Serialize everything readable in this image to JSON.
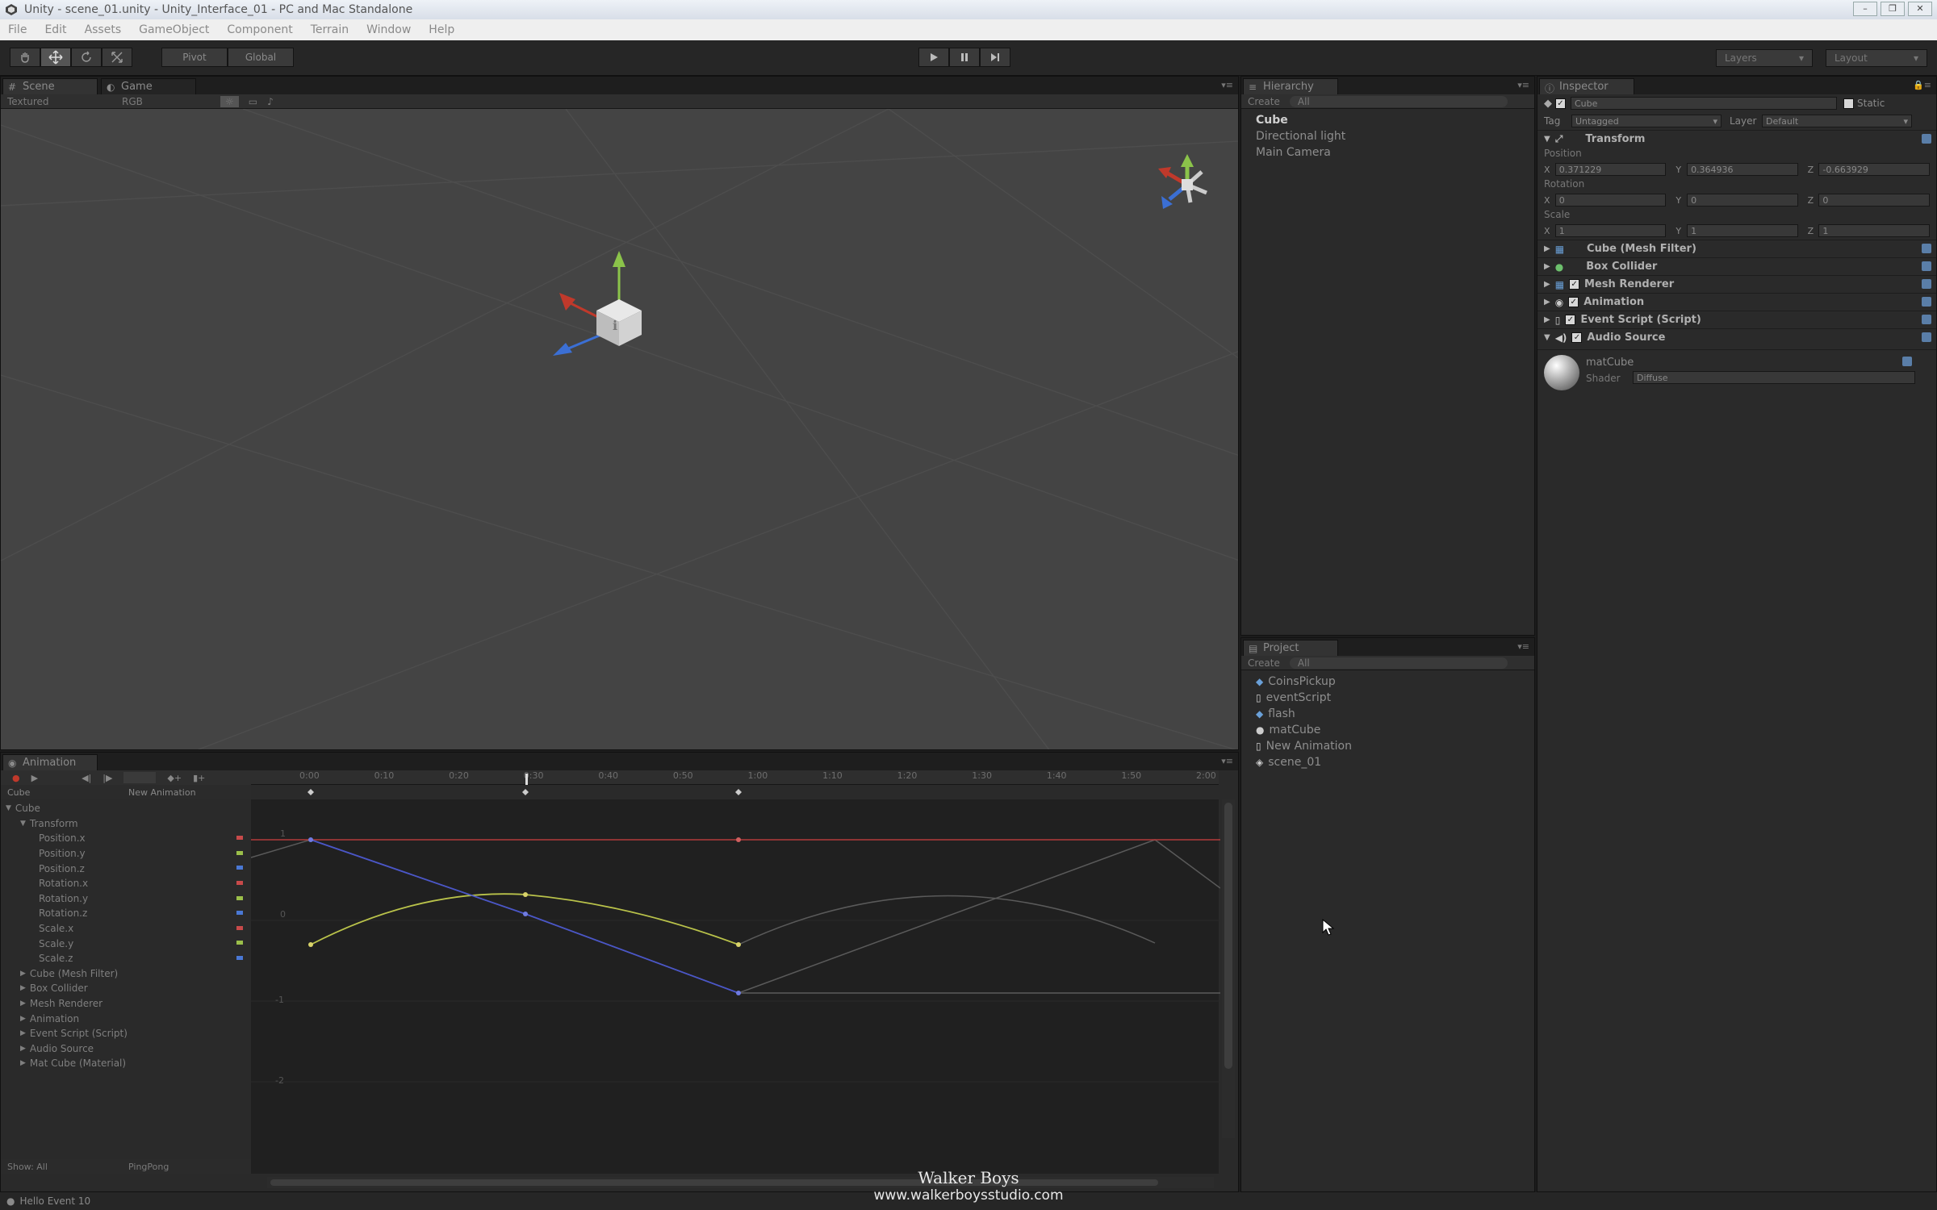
{
  "window": {
    "title": "Unity - scene_01.unity - Unity_Interface_01 - PC and Mac Standalone",
    "buttons": [
      "–",
      "❐",
      "✕"
    ]
  },
  "menu": [
    "File",
    "Edit",
    "Assets",
    "GameObject",
    "Component",
    "Terrain",
    "Window",
    "Help"
  ],
  "toolbar": {
    "tools": [
      "hand",
      "move",
      "rotate",
      "scale"
    ],
    "pivot_label": "Pivot",
    "global_label": "Global",
    "play_controls": [
      "play",
      "pause",
      "step"
    ],
    "layers_label": "Layers",
    "layout_label": "Layout"
  },
  "scene": {
    "tabs": [
      "Scene",
      "Game"
    ],
    "render_mode": "Textured",
    "color_mode": "RGB"
  },
  "hierarchy": {
    "tab": "Hierarchy",
    "create": "Create",
    "search": "All",
    "items": [
      "Cube",
      "Directional light",
      "Main Camera"
    ]
  },
  "project": {
    "tab": "Project",
    "create": "Create",
    "search": "All",
    "items": [
      {
        "label": "CoinsPickup",
        "icon": "prefab-icon"
      },
      {
        "label": "eventScript",
        "icon": "script-icon"
      },
      {
        "label": "flash",
        "icon": "prefab-icon"
      },
      {
        "label": "matCube",
        "icon": "material-icon"
      },
      {
        "label": "New Animation",
        "icon": "animation-icon"
      },
      {
        "label": "scene_01",
        "icon": "scene-icon"
      }
    ]
  },
  "inspector": {
    "tab": "Inspector",
    "object_name": "Cube",
    "static_label": "Static",
    "tag_label": "Tag",
    "tag_value": "Untagged",
    "layer_label": "Layer",
    "layer_value": "Default",
    "transform_label": "Transform",
    "position_label": "Position",
    "position": {
      "x": "0.371229",
      "y": "0.364936",
      "z": "-0.663929"
    },
    "rotation_label": "Rotation",
    "rotation": {
      "x": "0",
      "y": "0",
      "z": "0"
    },
    "scale_label": "Scale",
    "scale": {
      "x": "1",
      "y": "1",
      "z": "1"
    },
    "components": [
      "Cube (Mesh Filter)",
      "Box Collider",
      "Mesh Renderer",
      "Animation",
      "Event Script (Script)",
      "Audio Source"
    ],
    "material_name": "matCube",
    "shader_label": "Shader",
    "shader_value": "Diffuse"
  },
  "animation": {
    "tab": "Animation",
    "object": "Cube",
    "clip": "New Animation",
    "tree": [
      {
        "label": "Cube",
        "indent": 0
      },
      {
        "label": "Transform",
        "indent": 1
      },
      {
        "label": "Position.x",
        "indent": 2
      },
      {
        "label": "Position.y",
        "indent": 2
      },
      {
        "label": "Position.z",
        "indent": 2
      },
      {
        "label": "Rotation.x",
        "indent": 2
      },
      {
        "label": "Rotation.y",
        "indent": 2
      },
      {
        "label": "Rotation.z",
        "indent": 2
      },
      {
        "label": "Scale.x",
        "indent": 2
      },
      {
        "label": "Scale.y",
        "indent": 2
      },
      {
        "label": "Scale.z",
        "indent": 2
      },
      {
        "label": "Cube (Mesh Filter)",
        "indent": 1
      },
      {
        "label": "Box Collider",
        "indent": 1
      },
      {
        "label": "Mesh Renderer",
        "indent": 1
      },
      {
        "label": "Animation",
        "indent": 1
      },
      {
        "label": "Event Script (Script)",
        "indent": 1
      },
      {
        "label": "Audio Source",
        "indent": 1
      },
      {
        "label": "Mat Cube (Material)",
        "indent": 1
      }
    ],
    "ruler": [
      "0:00",
      "0:10",
      "0:20",
      "0:30",
      "0:40",
      "0:50",
      "1:00",
      "1:10",
      "1:20",
      "1:30",
      "1:40",
      "1:50",
      "2:00"
    ],
    "show_label": "Show: All",
    "wrap_label": "PingPong"
  },
  "status": {
    "message": "Hello Event 10"
  },
  "watermark": {
    "line1": "Walker Boys",
    "line2": "www.walkerboysstudio.com"
  },
  "colors": {
    "axis_x": "#c0392b",
    "axis_y": "#8bc34a",
    "axis_z": "#3b6fd4",
    "curve_x": "#b23a3a",
    "curve_y": "#b9c24a",
    "curve_z": "#4a56c8",
    "curve_ghost": "#5a5a5a"
  }
}
